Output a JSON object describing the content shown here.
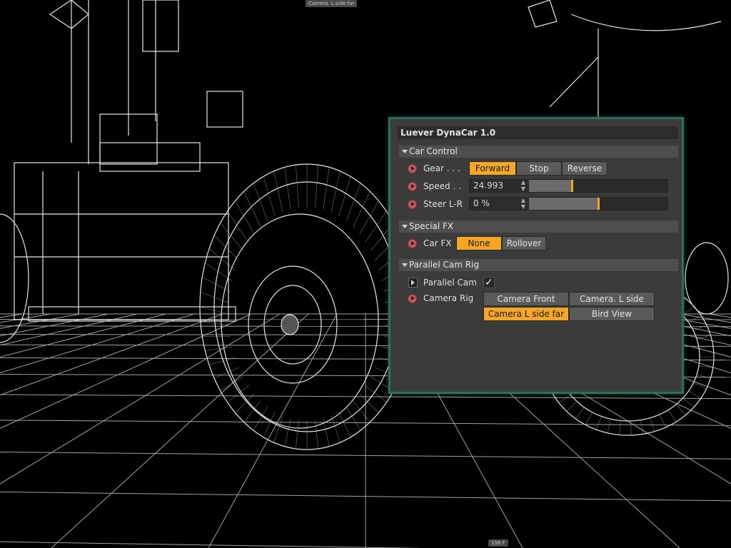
{
  "viewport": {
    "camera_label": "Camera. L side far",
    "frame_label": "156 F"
  },
  "panel": {
    "title": "Luever DynaCar 1.0",
    "accent_color": "#f4a724",
    "border_color": "#2f6e5c",
    "sections": {
      "car_control": {
        "header": "Car Control",
        "gear_label": "Gear . . .",
        "gear_options": [
          "Forward",
          "Stop",
          "Reverse"
        ],
        "gear_selected": "Forward",
        "speed_label": "Speed . .",
        "speed_value": "24.993",
        "speed_slider_fraction": 0.31,
        "steer_label": "Steer L-R",
        "steer_value": "0 %",
        "steer_slider_fraction": 0.5
      },
      "special_fx": {
        "header": "Special FX",
        "car_fx_label": "Car FX",
        "car_fx_options": [
          "None",
          "Rollover"
        ],
        "car_fx_selected": "None"
      },
      "parallel_cam_rig": {
        "header": "Parallel Cam Rig",
        "parallel_cam_label": "Parallel Cam",
        "parallel_cam_checked": true,
        "parallel_cam_check_glyph": "✓",
        "camera_rig_label": "Camera Rig",
        "camera_options": [
          "Camera Front",
          "Camera. L side",
          "Camera L side far",
          "Bird View"
        ],
        "camera_selected": "Camera L side far"
      }
    }
  }
}
